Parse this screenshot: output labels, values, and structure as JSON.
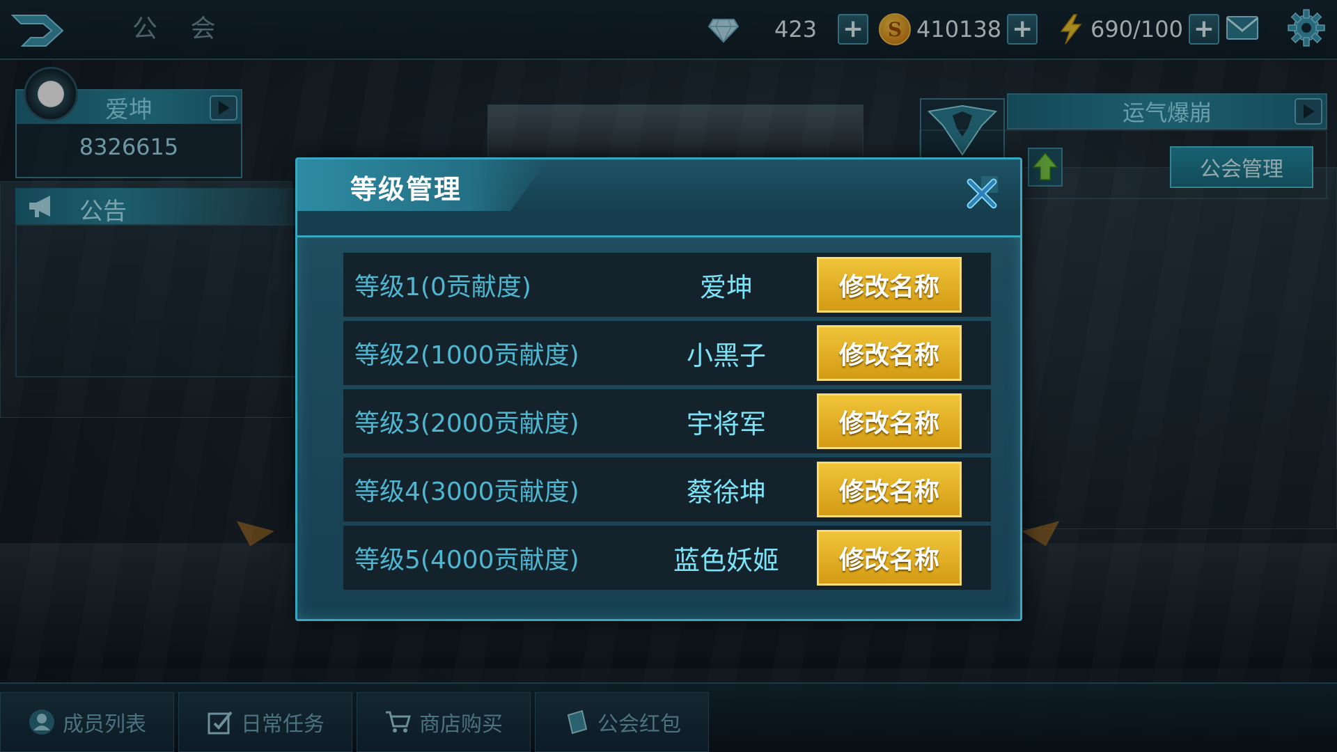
{
  "topbar": {
    "title": "公 会",
    "gems": "423",
    "coins": "410138",
    "energy": "690/100",
    "coin_symbol": "S"
  },
  "player": {
    "name": "爱坤",
    "id": "8326615"
  },
  "notice": {
    "label": "公告"
  },
  "guild": {
    "name": "运气爆崩",
    "manage_label": "公会管理"
  },
  "modal": {
    "title": "等级管理",
    "rows": [
      {
        "label": "等级1(0贡献度)",
        "name": "爱坤",
        "button": "修改名称"
      },
      {
        "label": "等级2(1000贡献度)",
        "name": "小黑子",
        "button": "修改名称"
      },
      {
        "label": "等级3(2000贡献度)",
        "name": "宇将军",
        "button": "修改名称"
      },
      {
        "label": "等级4(3000贡献度)",
        "name": "蔡徐坤",
        "button": "修改名称"
      },
      {
        "label": "等级5(4000贡献度)",
        "name": "蓝色妖姬",
        "button": "修改名称"
      }
    ]
  },
  "tabs": [
    {
      "label": "成员列表",
      "icon": "person-icon"
    },
    {
      "label": "日常任务",
      "icon": "task-icon"
    },
    {
      "label": "商店购买",
      "icon": "cart-icon"
    },
    {
      "label": "公会红包",
      "icon": "red-envelope-icon"
    }
  ],
  "colors": {
    "accent": "#3aa7c1",
    "button_gold": "#e2b028",
    "text_cyan": "#7ce3f7"
  }
}
